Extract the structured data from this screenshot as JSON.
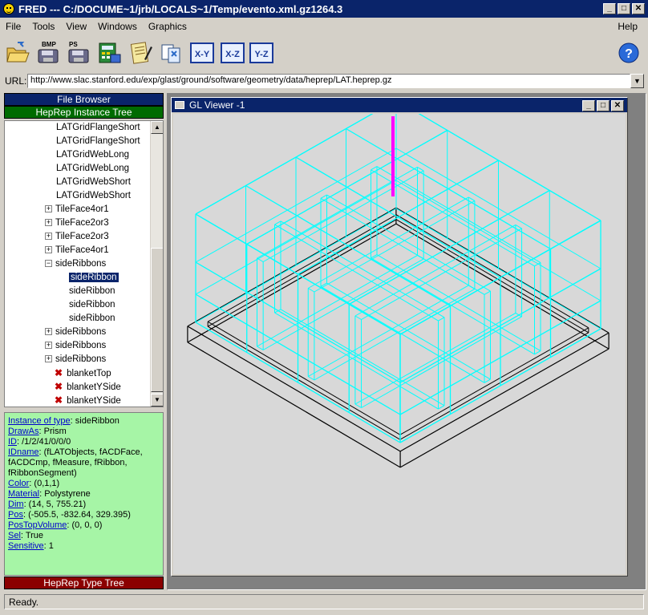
{
  "window": {
    "title": "FRED --- C:/DOCUME~1/jrb/LOCALS~1/Temp/evento.xml.gz1264.3"
  },
  "menu": {
    "file": "File",
    "tools": "Tools",
    "view": "View",
    "windows": "Windows",
    "graphics": "Graphics",
    "help": "Help"
  },
  "toolbar": {
    "bmp": "BMP",
    "ps": "PS",
    "xy": "X-Y",
    "xz": "X-Z",
    "yz": "Y-Z",
    "help_icon": "?"
  },
  "url": {
    "label": "URL:",
    "value": "http://www.slac.stanford.edu/exp/glast/ground/software/geometry/data/heprep/LAT.heprep.gz"
  },
  "left": {
    "file_browser": "File Browser",
    "instance_tree": "HepRep Instance Tree",
    "type_tree": "HepRep Type Tree",
    "tree": [
      {
        "label": "LATGridFlangeShort",
        "kind": "leaf",
        "indent": 0
      },
      {
        "label": "LATGridFlangeShort",
        "kind": "leaf",
        "indent": 0
      },
      {
        "label": "LATGridWebLong",
        "kind": "leaf",
        "indent": 0
      },
      {
        "label": "LATGridWebLong",
        "kind": "leaf",
        "indent": 0
      },
      {
        "label": "LATGridWebShort",
        "kind": "leaf",
        "indent": 0
      },
      {
        "label": "LATGridWebShort",
        "kind": "leaf",
        "indent": 0
      },
      {
        "label": "TileFace4or1",
        "kind": "plus",
        "indent": 0
      },
      {
        "label": "TileFace2or3",
        "kind": "plus",
        "indent": 0
      },
      {
        "label": "TileFace2or3",
        "kind": "plus",
        "indent": 0
      },
      {
        "label": "TileFace4or1",
        "kind": "plus",
        "indent": 0
      },
      {
        "label": "sideRibbons",
        "kind": "minus",
        "indent": 0
      },
      {
        "label": "sideRibbon",
        "kind": "leaf",
        "indent": 1,
        "selected": true
      },
      {
        "label": "sideRibbon",
        "kind": "leaf",
        "indent": 1
      },
      {
        "label": "sideRibbon",
        "kind": "leaf",
        "indent": 1
      },
      {
        "label": "sideRibbon",
        "kind": "leaf",
        "indent": 1
      },
      {
        "label": "sideRibbons",
        "kind": "plus",
        "indent": 0
      },
      {
        "label": "sideRibbons",
        "kind": "plus",
        "indent": 0
      },
      {
        "label": "sideRibbons",
        "kind": "plus",
        "indent": 0
      },
      {
        "label": "blanketTop",
        "kind": "x",
        "indent": 0
      },
      {
        "label": "blanketYSide",
        "kind": "x",
        "indent": 0
      },
      {
        "label": "blanketYSide",
        "kind": "x",
        "indent": 0
      }
    ],
    "props": [
      {
        "k": "Instance of type",
        "v": "sideRibbon"
      },
      {
        "k": "DrawAs",
        "v": "Prism"
      },
      {
        "k": "ID",
        "v": "/1/2/41/0/0/0"
      },
      {
        "k": "IDname",
        "v": "(fLATObjects, fACDFace, fACDCmp, fMeasure, fRibbon, fRibbonSegment)"
      },
      {
        "k": "Color",
        "v": "(0,1,1)"
      },
      {
        "k": "Material",
        "v": "Polystyrene"
      },
      {
        "k": "Dim",
        "v": "(14, 5, 755.21)"
      },
      {
        "k": "Pos",
        "v": "(-505.5, -832.64, 329.395)"
      },
      {
        "k": "PosTopVolume",
        "v": "(0, 0, 0)"
      },
      {
        "k": "Sel",
        "v": "True"
      },
      {
        "k": "Sensitive",
        "v": "1"
      }
    ]
  },
  "viewer": {
    "title": "GL Viewer -1",
    "wire_color": "#00ffff",
    "base_color": "#000000",
    "highlight_color": "#ff00ff"
  },
  "status": {
    "text": "Ready."
  }
}
